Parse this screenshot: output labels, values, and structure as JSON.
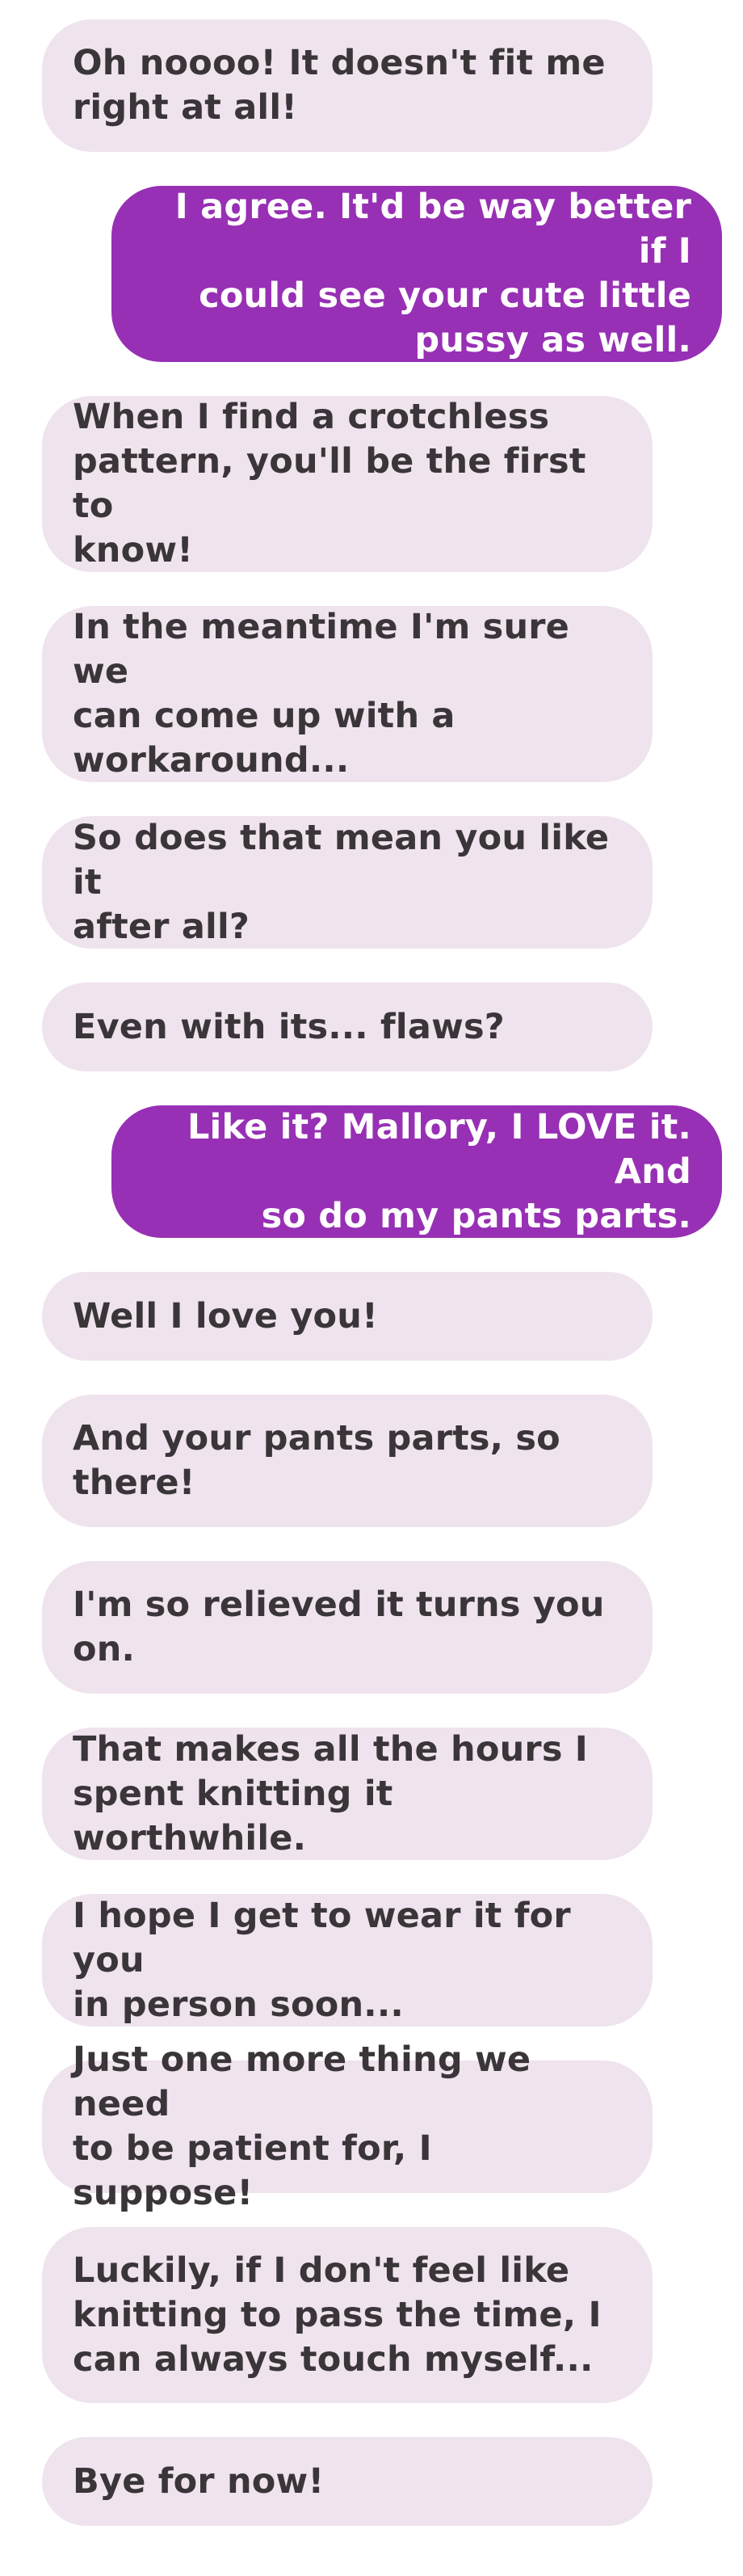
{
  "conversation": {
    "messages": [
      {
        "from": "received",
        "text": "Oh noooo! It doesn't fit me\nright at all!"
      },
      {
        "from": "sent",
        "text": "I agree. It'd be way better if I\ncould see your cute little\npussy as well."
      },
      {
        "from": "received",
        "text": "When I find a crotchless\npattern, you'll be the first to\nknow!"
      },
      {
        "from": "received",
        "text": "In the meantime I'm sure we\ncan come up with a\nworkaround..."
      },
      {
        "from": "received",
        "text": "So does that mean you like it\nafter all?"
      },
      {
        "from": "received",
        "text": "Even with its... flaws?"
      },
      {
        "from": "sent",
        "text": "Like it? Mallory, I LOVE it. And\nso do my pants parts."
      },
      {
        "from": "received",
        "text": "Well I love you!"
      },
      {
        "from": "received",
        "text": "And your pants parts, so\nthere!"
      },
      {
        "from": "received",
        "text": "I'm so relieved it turns you on."
      },
      {
        "from": "received",
        "text": "That makes all the hours I\nspent knitting it worthwhile."
      },
      {
        "from": "received",
        "text": "I hope I get to wear it for you\nin person soon..."
      },
      {
        "from": "received",
        "text": "Just one more thing we need\nto be patient for, I suppose!"
      },
      {
        "from": "received",
        "text": "Luckily, if I don't feel like\nknitting to pass the time, I\ncan always touch myself..."
      },
      {
        "from": "received",
        "text": "Bye for now!"
      }
    ]
  },
  "colors": {
    "received_bubble": "#efe3ee",
    "received_text": "#3a3539",
    "sent_bubble": "#9730b4",
    "sent_text": "#ffffff",
    "background": "#ffffff"
  }
}
